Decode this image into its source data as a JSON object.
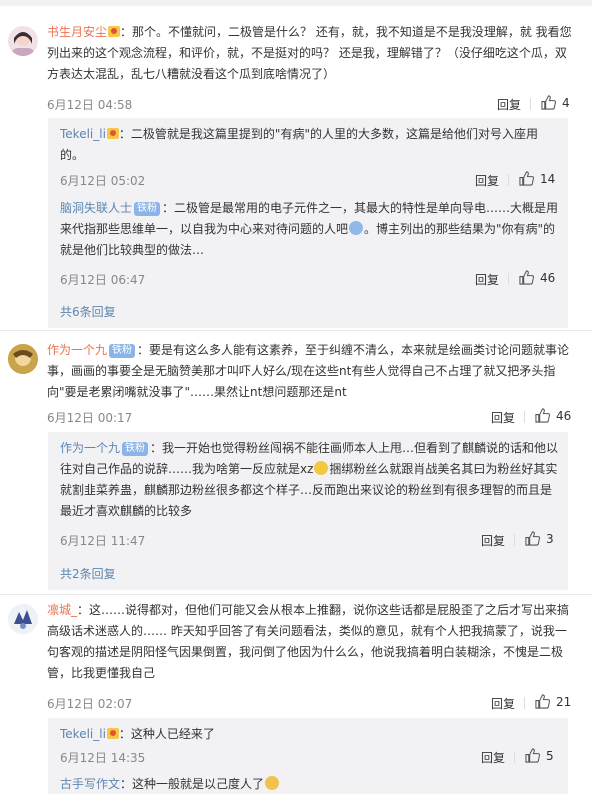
{
  "comments": [
    {
      "username": "书生月安尘",
      "text": "：那个。不懂就问，二极管是什么？ 还有，就，我不知道是不是我没理解，就 我看您列出来的这个观念流程，和评价，就，不是挺对的吗？ 还是我，理解错了？（没仔细吃这个瓜，双方表达太混乱，乱七八糟就没看这个瓜到底啥情况了）",
      "time": "6月12日 04:58",
      "reply_label": "回复",
      "likes": "4",
      "replies": [
        {
          "username": "Tekeli_li",
          "text": "：二极管就是我这篇里提到的\"有病\"的人里的大多数，这篇是给他们对号入座用的。",
          "time": "6月12日 05:02",
          "reply_label": "回复",
          "likes": "14"
        },
        {
          "username": "脑洞失联人士",
          "badge": "铁粉",
          "text_a": "：二极管是最常用的电子元件之一，其最大的特性是单向导电……大概是用来代指那些思维单一，以自我为中心来对待问题的人吧",
          "text_b": "。博主列出的那些结果为\"你有病\"的就是他们比较典型的做法…",
          "time": "6月12日 06:47",
          "reply_label": "回复",
          "likes": "46"
        }
      ],
      "more_replies": "共6条回复"
    },
    {
      "username": "作为一个九",
      "badge": "铁粉",
      "text": "：要是有这么多人能有这素养，至于纠缠不清么，本来就是绘画类讨论问题就事论事，画画的事要全是无脑赞美那才叫吓人好么/现在这些nt有些人觉得自己不占理了就又把矛头指向\"要是老累闭嘴就没事了\"……果然让nt想问题那还是nt",
      "time": "6月12日 00:17",
      "reply_label": "回复",
      "likes": "46",
      "replies": [
        {
          "username": "作为一个九",
          "badge": "铁粉",
          "text_a": "：我一开始也觉得粉丝闯祸不能往画师本人上甩…但看到了麒麟说的话和他以往对自己作品的说辞……我为啥第一反应就是xz",
          "text_b": "捆绑粉丝么就跟肖战美名其曰为粉丝好其实就割韭菜养蛊，麒麟那边粉丝很多都这个样子…反而跑出来议论的粉丝到有很多理智的而且是最近才喜欢麒麟的比较多",
          "time": "6月12日 11:47",
          "reply_label": "回复",
          "likes": "3"
        }
      ],
      "more_replies": "共2条回复"
    },
    {
      "username": "凛城_",
      "text": "：这……说得都对，但他们可能又会从根本上推翻，说你这些话都是屁股歪了之后才写出来搞高级话术迷惑人的…… 昨天知乎回答了有关问题看法，类似的意见，就有个人把我搞蒙了，说我一句客观的描述是阴阳怪气因果倒置，我问倒了他因为什么么，他说我搞着明白装糊涂，不愧是二极管，比我更懂我自己",
      "time": "6月12日 02:07",
      "reply_label": "回复",
      "likes": "21",
      "replies": [
        {
          "username": "Tekeli_li",
          "text": "：这种人已经来了",
          "time": "6月12日 14:35",
          "reply_label": "回复",
          "likes": "5"
        },
        {
          "username": "古手写作文",
          "text": "：这种一般就是以己度人了"
        }
      ]
    }
  ],
  "icons": {
    "like": "thumbs-up-icon",
    "vip": "vip-badge-icon",
    "emoji": "emoji-icon"
  },
  "colors": {
    "username": "#eb7350",
    "reply_username": "#5d86b0",
    "reply_bg": "#f2f2f5",
    "badge": "#8cb4e8"
  }
}
